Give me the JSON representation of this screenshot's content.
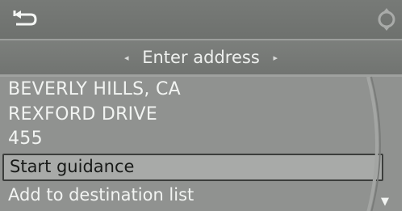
{
  "header": {
    "title": "Enter address",
    "left_arrow": "◂",
    "right_arrow": "▸"
  },
  "address": {
    "city": "BEVERLY HILLS, CA",
    "street": "REXFORD DRIVE",
    "number": "455"
  },
  "menu": {
    "items": [
      {
        "label": "Start guidance",
        "selected": true
      },
      {
        "label": "Add to destination list",
        "selected": false
      }
    ]
  },
  "icons": {
    "back": "back-arrow-icon",
    "controller": "rotate-controller-icon",
    "scroll_down": "scroll-down-arrow-icon"
  },
  "colors": {
    "background": "#8d8f8d",
    "highlight": "#a8aaa8",
    "text": "#f2f4f2"
  }
}
